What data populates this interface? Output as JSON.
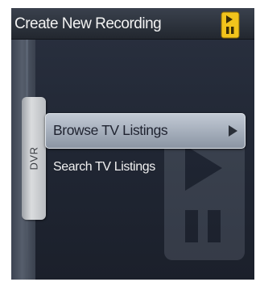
{
  "header": {
    "title": "Create New Recording",
    "icon": "media-player-icon"
  },
  "side_tab": {
    "label": "DVR"
  },
  "menu": {
    "items": [
      {
        "label": "Browse TV Listings",
        "selected": true,
        "icon": "arrow-right-icon"
      },
      {
        "label": "Search TV Listings",
        "selected": false
      }
    ]
  },
  "colors": {
    "accent": "#f0c419",
    "highlight": "#b3bcc8",
    "background": "#232a36"
  }
}
